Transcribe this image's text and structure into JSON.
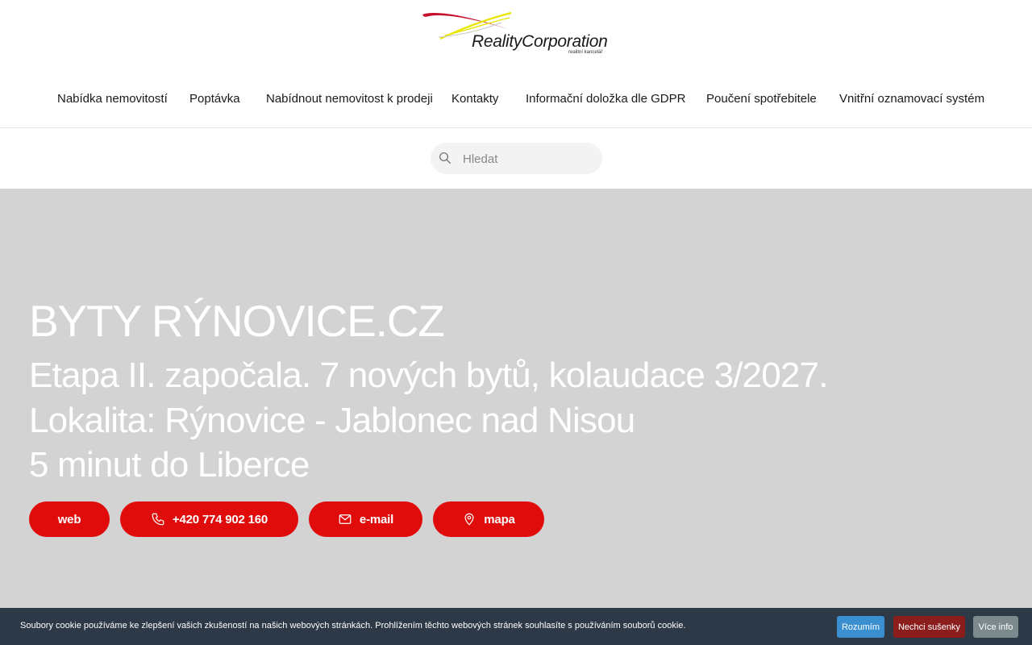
{
  "brand": {
    "name": "RealityCorporation",
    "tagline": "realitní kancelář",
    "colors": {
      "red": "#c8102e",
      "yellow": "#e8e600"
    }
  },
  "nav": {
    "items": [
      "Nabídka nemovitostí",
      "Poptávka",
      "Nabídnout nemovitost k prodeji",
      "Kontakty",
      "Informační doložka dle GDPR",
      "Poučení spotřebitele",
      "Vnitřní oznamovací systém"
    ]
  },
  "search": {
    "placeholder": "Hledat",
    "value": "",
    "icon": "search-icon"
  },
  "hero": {
    "title": "BYTY RÝNOVICE.CZ",
    "lines": [
      "Etapa II. započala. 7 nových bytů, kolaudace 3/2027.",
      "Lokalita: Rýnovice - Jablonec nad Nisou",
      "5 minut do Liberce"
    ],
    "buttons": [
      {
        "label": "web",
        "icon": ""
      },
      {
        "label": "+420 774 902 160",
        "icon": "phone-icon"
      },
      {
        "label": "e-mail",
        "icon": "mail-icon"
      },
      {
        "label": "mapa",
        "icon": "map-pin-icon"
      }
    ],
    "colors": {
      "background": "#d3d3d3",
      "button": "#e00b0b"
    }
  },
  "cookie": {
    "message": "Soubory cookie používáme ke zlepšení vašich zkušeností na našich webových stránkách. Prohlížením těchto webových stránek souhlasíte s používáním souborů cookie.",
    "accept_label": "Rozumím",
    "decline_label": "Nechci sušenky",
    "info_label": "Více info",
    "colors": {
      "bar": "#2d3947",
      "accept": "#3a8fd1",
      "decline": "#8b1d1d",
      "info": "#7d8a8d"
    }
  }
}
